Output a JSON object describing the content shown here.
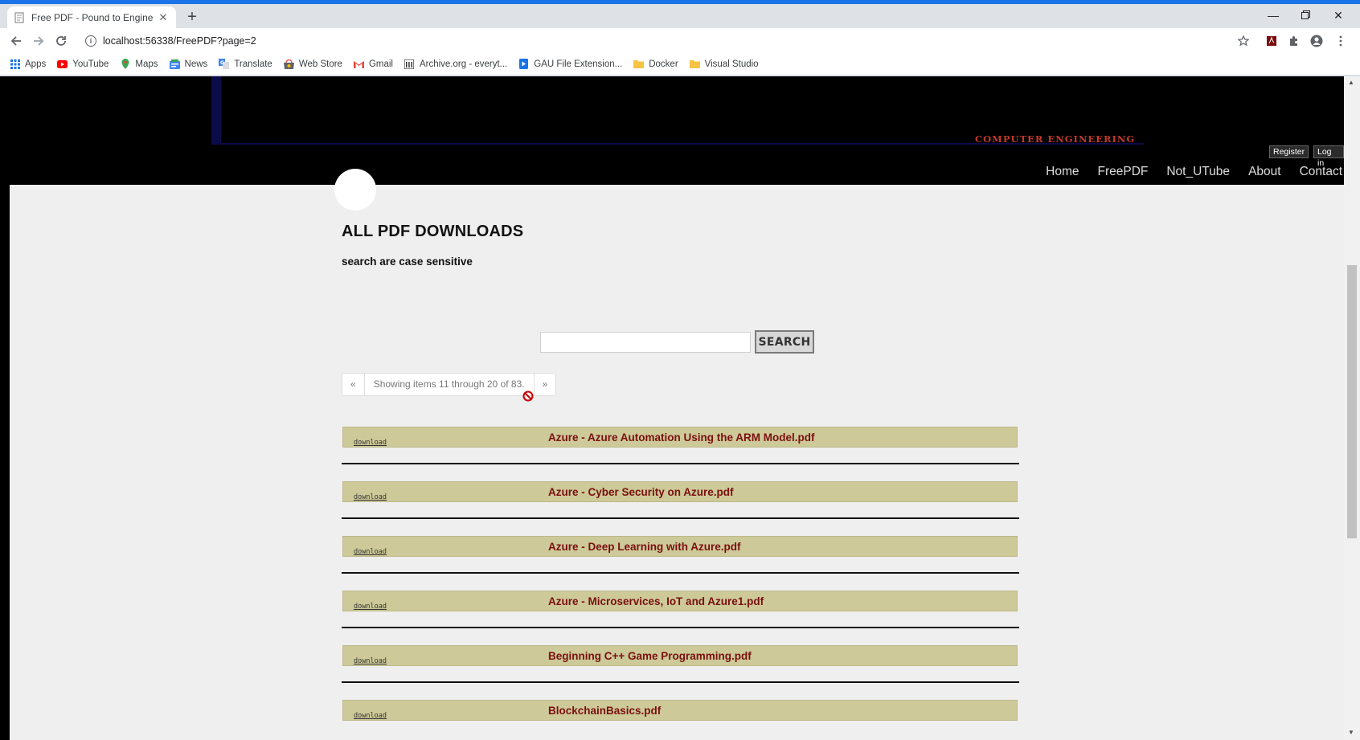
{
  "browser": {
    "tab_title": "Free PDF - Pound to Engineering",
    "url": "localhost:56338/FreePDF?page=2",
    "bookmarks": [
      {
        "label": "Apps",
        "icon": "apps-grid-icon"
      },
      {
        "label": "YouTube",
        "icon": "youtube-icon"
      },
      {
        "label": "Maps",
        "icon": "maps-icon"
      },
      {
        "label": "News",
        "icon": "news-icon"
      },
      {
        "label": "Translate",
        "icon": "translate-icon"
      },
      {
        "label": "Web Store",
        "icon": "web-store-icon"
      },
      {
        "label": "Gmail",
        "icon": "gmail-icon"
      },
      {
        "label": "Archive.org - everyt...",
        "icon": "archive-icon"
      },
      {
        "label": "GAU File Extension...",
        "icon": "gau-icon"
      },
      {
        "label": "Docker",
        "icon": "folder-icon"
      },
      {
        "label": "Visual Studio",
        "icon": "folder-icon"
      }
    ]
  },
  "site": {
    "brand": "COMPUTER ENGINEERING",
    "register": "Register",
    "login": "Log in",
    "nav": [
      "Home",
      "FreePDF",
      "Not_UTube",
      "About",
      "Contact"
    ]
  },
  "main": {
    "title": "ALL PDF DOWNLOADS",
    "subtitle": "search are case sensitive",
    "search_button": "SEARCH",
    "search_value": "",
    "pager": {
      "prev": "«",
      "status": "Showing items 11 through 20 of 83.",
      "next": "»"
    },
    "download_label": "download",
    "pdfs": [
      "Azure - Azure Automation Using the ARM Model.pdf",
      "Azure - Cyber Security on Azure.pdf",
      "Azure - Deep Learning with Azure.pdf",
      "Azure - Microservices, IoT and Azure1.pdf",
      "Beginning C++ Game Programming.pdf",
      "BlockchainBasics.pdf"
    ]
  },
  "colors": {
    "row_bg": "#cdc998",
    "link_red": "#7a1010",
    "brand_red": "#c0392b",
    "header_bg": "#000000",
    "page_bg": "#efefef"
  }
}
